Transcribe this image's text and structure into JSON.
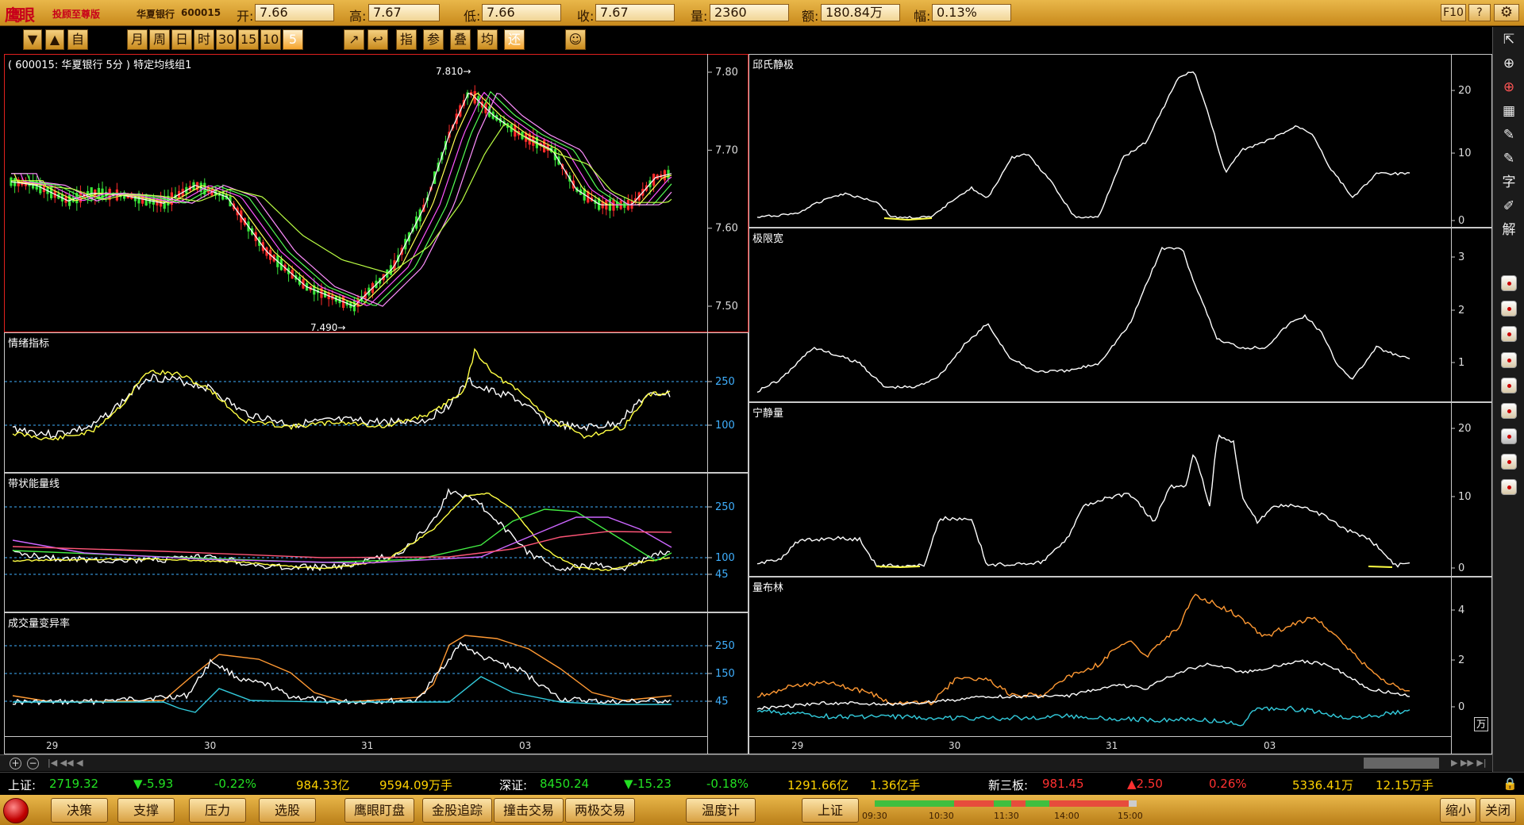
{
  "header": {
    "logo": "鹰眼",
    "edition": "投顾至尊版",
    "stock_name": "华夏银行",
    "stock_code": "600015",
    "quotes": [
      {
        "label": "开:",
        "value": "7.66"
      },
      {
        "label": "高:",
        "value": "7.67"
      },
      {
        "label": "低:",
        "value": "7.66"
      },
      {
        "label": "收:",
        "value": "7.67"
      },
      {
        "label": "量:",
        "value": "2360"
      },
      {
        "label": "额:",
        "value": "180.84万"
      },
      {
        "label": "幅:",
        "value": "0.13%"
      }
    ],
    "f10": "F10",
    "help": "?"
  },
  "toolbar": {
    "nav": [
      "▼",
      "▲",
      "自"
    ],
    "periods": [
      "月",
      "周",
      "日",
      "时",
      "30",
      "15",
      "10",
      "5"
    ],
    "active_period": "5",
    "tools": [
      "↗",
      "↩",
      "指",
      "参",
      "叠",
      "均",
      "还"
    ]
  },
  "main_pane": {
    "title": "( 600015: 华夏银行 5分 ) 特定均线组1",
    "high_mark": "7.810→",
    "low_mark": "7.490→",
    "price_ticks": [
      "7.80",
      "7.70",
      "7.60",
      "7.50"
    ],
    "price_values": [
      7.8,
      7.7,
      7.6,
      7.5
    ]
  },
  "left_panes": [
    {
      "title": "情绪指标",
      "ticks": [
        "250",
        "100"
      ]
    },
    {
      "title": "带状能量线",
      "ticks": [
        "250",
        "100",
        "45"
      ]
    },
    {
      "title": "成交量变异率",
      "ticks": [
        "250",
        "150",
        "45"
      ]
    }
  ],
  "right_panes": [
    {
      "title": "邱氏静极",
      "ticks": [
        "20",
        "10",
        "0"
      ]
    },
    {
      "title": "极限宽",
      "ticks": [
        "3",
        "2",
        "1"
      ]
    },
    {
      "title": "宁静量",
      "ticks": [
        "20",
        "10",
        "0"
      ]
    },
    {
      "title": "量布林",
      "ticks": [
        "4",
        "2",
        "0"
      ],
      "unit": "万"
    }
  ],
  "x_dates": [
    "29",
    "30",
    "31",
    "03"
  ],
  "index_bar": [
    {
      "name": "上证:",
      "value": "2719.32",
      "chg": "▼-5.93",
      "pct": "-0.22%",
      "amt": "984.33亿",
      "vol": "9594.09万手"
    },
    {
      "name": "深证:",
      "value": "8450.24",
      "chg": "▼-15.23",
      "pct": "-0.18%",
      "amt": "1291.66亿",
      "vol": "1.36亿手"
    },
    {
      "name": "新三板:",
      "value": "981.45",
      "chg": "▲2.50",
      "pct": "0.26%",
      "amt": "5336.41万",
      "vol": "12.15万手"
    }
  ],
  "bottom_buttons": [
    "决策",
    "支撑",
    "压力",
    "选股",
    "鹰眼盯盘",
    "金股追踪",
    "撞击交易",
    "两极交易",
    "温度计",
    "上证"
  ],
  "bottom_right": [
    "缩小",
    "关闭"
  ],
  "timeline": [
    "09:30",
    "10:30",
    "11:30",
    "14:00",
    "15:00"
  ],
  "right_sidebar": [
    "⇱",
    "⊕",
    "⊕",
    "▦",
    "✎",
    "✎",
    "字",
    "✐",
    "解"
  ]
}
